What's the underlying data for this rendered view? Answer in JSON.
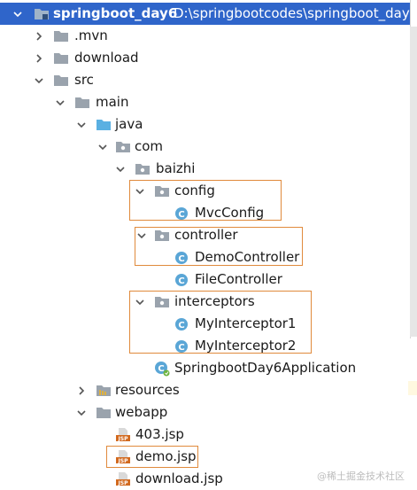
{
  "tree": {
    "project": {
      "name": "springboot_day6",
      "path": "D:\\springbootcodes\\springboot_day"
    },
    "items": [
      {
        "label": "springboot_day6",
        "icon": "module-folder-icon"
      },
      {
        "label": ".mvn",
        "icon": "folder-icon"
      },
      {
        "label": "download",
        "icon": "folder-icon"
      },
      {
        "label": "src",
        "icon": "folder-icon"
      },
      {
        "label": "main",
        "icon": "folder-icon"
      },
      {
        "label": "java",
        "icon": "source-folder-icon"
      },
      {
        "label": "com",
        "icon": "package-icon"
      },
      {
        "label": "baizhi",
        "icon": "package-icon"
      },
      {
        "label": "config",
        "icon": "package-icon"
      },
      {
        "label": "MvcConfig",
        "icon": "class-icon"
      },
      {
        "label": "controller",
        "icon": "package-icon"
      },
      {
        "label": "DemoController",
        "icon": "class-icon"
      },
      {
        "label": "FileController",
        "icon": "class-icon"
      },
      {
        "label": "interceptors",
        "icon": "package-icon"
      },
      {
        "label": "MyInterceptor1",
        "icon": "class-icon"
      },
      {
        "label": "MyInterceptor2",
        "icon": "class-icon"
      },
      {
        "label": "SpringbootDay6Application",
        "icon": "spring-boot-class-icon"
      },
      {
        "label": "resources",
        "icon": "resources-folder-icon"
      },
      {
        "label": "webapp",
        "icon": "folder-icon"
      },
      {
        "label": "403.jsp",
        "icon": "jsp-file-icon"
      },
      {
        "label": "demo.jsp",
        "icon": "jsp-file-icon"
      },
      {
        "label": "download.jsp",
        "icon": "jsp-file-icon"
      }
    ]
  },
  "watermark": "@稀土掘金技术社区",
  "colors": {
    "selection": "#2f65ca",
    "highlight_box": "#e08a3c",
    "class_icon": "#5aa6d6",
    "folder": "#9aa3ad",
    "source_folder": "#5ab0e2",
    "jsp": "#d2691e"
  }
}
